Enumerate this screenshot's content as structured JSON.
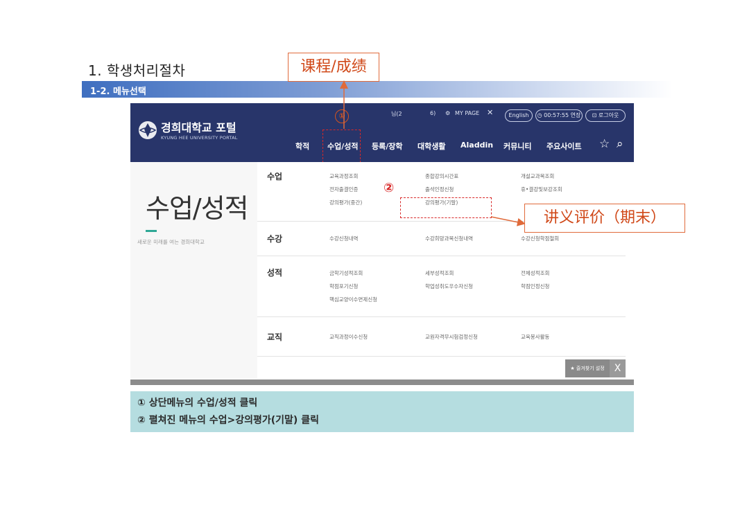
{
  "document": {
    "title": "1. 학생처리절차",
    "section": "1-2. 메뉴선택",
    "callout_top": "课程/成绩",
    "callout_right": "讲义评价（期末）"
  },
  "portal": {
    "brand_name": "경희대학교 포털",
    "brand_sub": "KYUNG HEE UNIVERSITY PORTAL",
    "user_label": "님(2",
    "user_count": "6)",
    "mypage": "MY PAGE",
    "english": "English",
    "timer": "00:57:55 연장",
    "logout": "로그아웃",
    "nav": [
      "학적",
      "수업/성적",
      "등록/장학",
      "대학생활",
      "Aladdin",
      "커뮤니티",
      "주요사이트"
    ],
    "side_title": "수업/성적",
    "side_sub": "새로운 미래를 여는 경희대학교",
    "menu": [
      {
        "head": "수업",
        "col1": [
          "교육과정조회",
          "전자출결인증",
          "강의평가(중간)"
        ],
        "col2": [
          "종합강의시간표",
          "출석인정신청",
          "강의평가(기말)"
        ],
        "col3": [
          "개설교과목조회",
          "휴•결강및보강조회"
        ]
      },
      {
        "head": "수강",
        "col1": [
          "수강신청내역"
        ],
        "col2": [
          "수강희망과목신청내역"
        ],
        "col3": [
          "수강신청학점철회"
        ]
      },
      {
        "head": "성적",
        "col1": [
          "금학기성적조회",
          "학점포기신청",
          "핵심교양이수면제신청"
        ],
        "col2": [
          "세부성적조회",
          "학업성취도우수자신청"
        ],
        "col3": [
          "전체성적조회",
          "학점인정신청"
        ]
      },
      {
        "head": "교직",
        "col1": [
          "교직과정이수신청"
        ],
        "col2": [
          "교원자격무시험검정신청"
        ],
        "col3": [
          "교육봉사활동"
        ]
      }
    ],
    "fav_button": "★ 즐겨찾기 설정",
    "close_button": "X",
    "marker1": "①",
    "marker2": "②"
  },
  "instructions": {
    "line1": "① 상단메뉴의 수업/성적 클릭",
    "line2": "② 펼쳐진 메뉴의 수업>강의평가(기말) 클릭"
  },
  "colors": {
    "header_navy": "#28356a",
    "callout_orange": "#e06a3a",
    "highlight_red": "#d82828",
    "instruction_bg": "#b5dde0",
    "accent_teal": "#2fa896"
  }
}
